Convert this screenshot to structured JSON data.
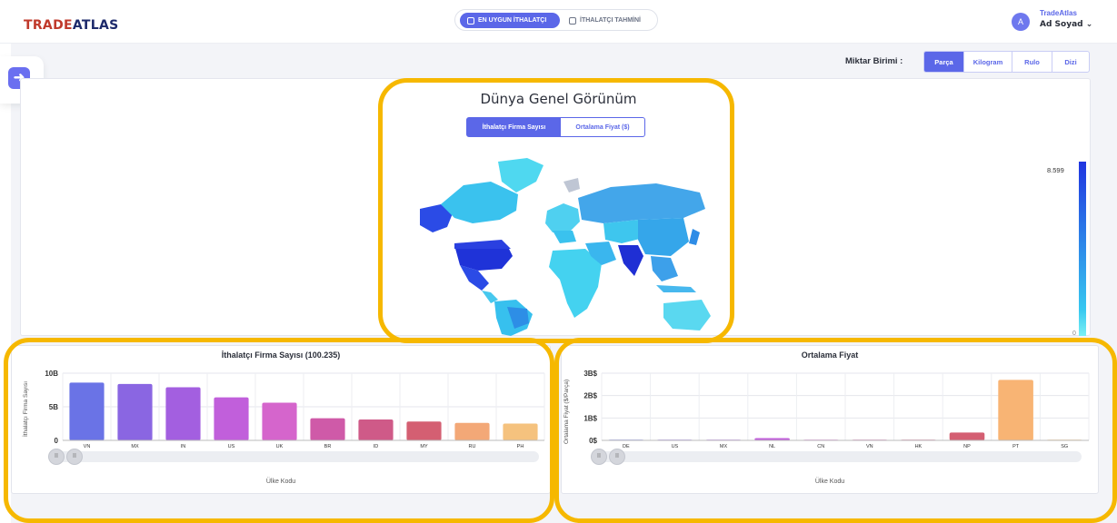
{
  "header": {
    "logo_part1": "TRADE",
    "logo_part2": "ATLAS",
    "mode_active": "EN UYGUN İTHALATÇI",
    "mode_inactive": "İTHALATÇI TAHMİNİ",
    "user_company": "TradeAtlas",
    "user_name": "Ad Soyad ⌄",
    "avatar_letter": "A"
  },
  "unit_selector": {
    "label": "Miktar Birimi :",
    "options": [
      "Parça",
      "Kilogram",
      "Rulo",
      "Dizi"
    ],
    "selected": "Parça"
  },
  "world_map": {
    "title": "Dünya Genel Görünüm",
    "tabs": [
      "İthalatçı Firma Sayısı",
      "Ortalama Fiyat ($)"
    ],
    "active_tab": "İthalatçı Firma Sayısı",
    "legend_max": "8.599",
    "legend_min": "0"
  },
  "chart_data": [
    {
      "type": "bar",
      "title": "İthalatçı Firma Sayısı (100.235)",
      "xlabel": "Ülke Kodu",
      "ylabel": "İthalatçı Firma Sayısı",
      "yticks": [
        "0",
        "5B",
        "10B"
      ],
      "ylim": [
        0,
        10
      ],
      "categories": [
        "VN",
        "MX",
        "IN",
        "US",
        "UK",
        "BR",
        "ID",
        "MY",
        "RU",
        "PH"
      ],
      "values": [
        8.6,
        8.4,
        7.9,
        6.4,
        5.6,
        3.3,
        3.1,
        2.8,
        2.6,
        2.5
      ],
      "colors": [
        "#6a73e6",
        "#8a66e2",
        "#a35fe0",
        "#c15fdb",
        "#d565cc",
        "#cf5aa8",
        "#cf5a88",
        "#d45f72",
        "#f3a877",
        "#f5c27e"
      ]
    },
    {
      "type": "bar",
      "title": "Ortalama Fiyat",
      "xlabel": "Ülke Kodu",
      "ylabel": "Ortalama Fiyat ($/Parça)",
      "yticks": [
        "0$",
        "1B$",
        "2B$",
        "3B$"
      ],
      "ylim": [
        0,
        3
      ],
      "categories": [
        "DE",
        "US",
        "MX",
        "NL",
        "CN",
        "VN",
        "HK",
        "NP",
        "PT",
        "SG"
      ],
      "values": [
        0.02,
        0.02,
        0.0,
        0.1,
        0.0,
        0.0,
        0.0,
        0.35,
        2.7,
        0.0
      ],
      "colors": [
        "#6a73e6",
        "#8a66e2",
        "#a35fe0",
        "#c15fdb",
        "#d565cc",
        "#cf5aa8",
        "#cf5a88",
        "#d45f72",
        "#f8b474",
        "#f5c27e"
      ]
    }
  ],
  "colors": {
    "accent": "#5b67e8",
    "highlight": "#f6b800",
    "map_dark": "#2035e0",
    "map_light": "#37d4f0"
  }
}
